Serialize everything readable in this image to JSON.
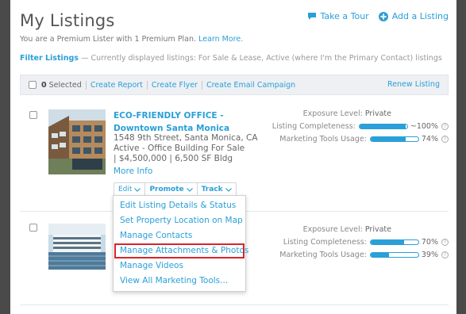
{
  "header": {
    "title": "My Listings",
    "take_tour": "Take a Tour",
    "add_listing": "Add a Listing"
  },
  "subheader": {
    "text": "You are a Premium Lister with 1 Premium Plan.",
    "learn_more": "Learn More."
  },
  "filter": {
    "label": "Filter Listings",
    "text": "— Currently displayed listings: For Sale & Lease, Active (where I'm the Primary Contact) listings"
  },
  "toolbar": {
    "selected_count": "0",
    "selected_label": "Selected",
    "create_report": "Create Report",
    "create_flyer": "Create Flyer",
    "create_email": "Create Email Campaign",
    "renew": "Renew Listing"
  },
  "listings": [
    {
      "title": "ECO-FRIENDLY OFFICE - Downtown Santa Monica",
      "address": "1548 9th Street, Santa Monica, CA",
      "status": "Active - Office Building For Sale",
      "price": "| $4,500,000 | 6,500 SF Bldg",
      "more_info": "More Info",
      "exposure_label": "Exposure Level:",
      "exposure_value": "Private",
      "completeness_label": "Listing Completeness:",
      "completeness_value": "~100%",
      "completeness_fill": 0.97,
      "marketing_label": "Marketing Tools Usage:",
      "marketing_value": "74%",
      "marketing_fill": 0.74
    },
    {
      "exposure_label": "Exposure Level:",
      "exposure_value": "Private",
      "completeness_label": "Listing Completeness:",
      "completeness_value": "70%",
      "completeness_fill": 0.7,
      "marketing_label": "Marketing Tools Usage:",
      "marketing_value": "39%",
      "marketing_fill": 0.39
    }
  ],
  "actions": {
    "edit": "Edit",
    "promote": "Promote",
    "track": "Track"
  },
  "edit_menu": [
    "Edit Listing Details & Status",
    "Set Property Location on Map",
    "Manage Contacts",
    "Manage Attachments & Photos",
    "Manage Videos",
    "View All Marketing Tools..."
  ],
  "colors": {
    "accent": "#2a9fd8",
    "highlight": "#d9242b",
    "frame": "#4a4a4a"
  }
}
